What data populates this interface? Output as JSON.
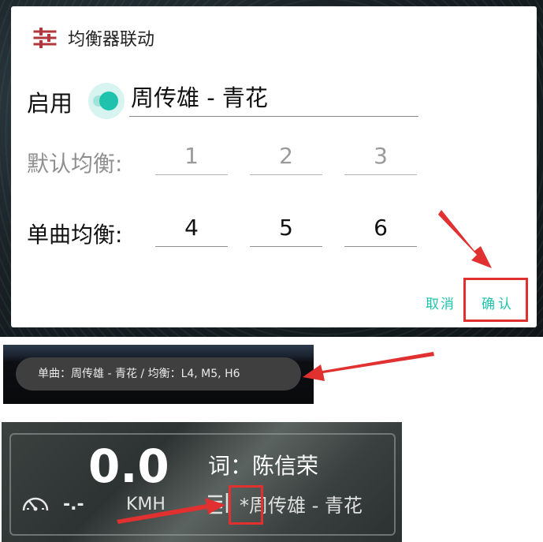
{
  "dialog": {
    "title": "均衡器联动",
    "enable_label": "启用",
    "song_value": "周传雄 - 青花",
    "default_eq_label": "默认均衡:",
    "default_eq_values": [
      "1",
      "2",
      "3"
    ],
    "single_eq_label": "单曲均衡:",
    "single_eq_values": [
      "4",
      "5",
      "6"
    ],
    "cancel_label": "取消",
    "ok_label": "确认",
    "toggle_on": true
  },
  "toast": {
    "text": "单曲：周传雄 - 青花 / 均衡：L4, M5, H6"
  },
  "hud": {
    "speed": "0.0",
    "unit": "KMH",
    "gauge_value": "-.-",
    "lyric_line": "词：陈信荣",
    "song_line": "*周传雄 - 青花"
  },
  "colors": {
    "accent": "#1fc3ad",
    "highlight": "#e03030",
    "icon_red": "#b2373c"
  },
  "icons": {
    "title_icon": "equalizer-icon",
    "gauge_icon": "speedometer-icon",
    "playlist_icon": "playlist-icon"
  }
}
